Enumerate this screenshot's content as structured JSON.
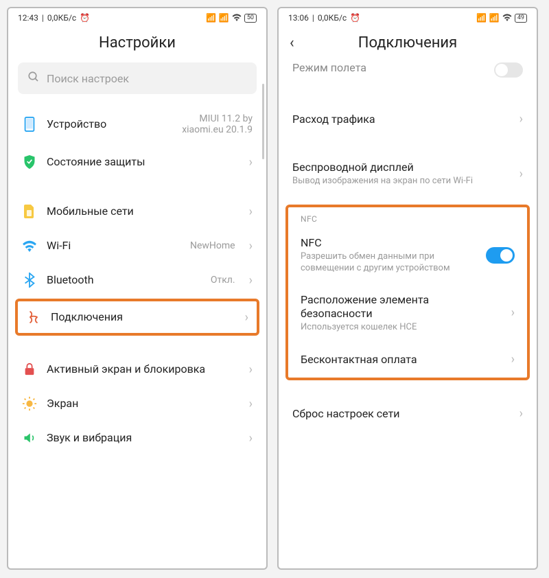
{
  "left": {
    "status": {
      "time": "12:43",
      "data": "0,0КБ/с",
      "battery": "50"
    },
    "title": "Настройки",
    "search_placeholder": "Поиск настроек",
    "rows": {
      "device": {
        "label": "Устройство",
        "right": "MIUI 11.2 by xiaomi.eu 20.1.9"
      },
      "security": {
        "label": "Состояние защиты"
      },
      "mobile": {
        "label": "Мобильные сети"
      },
      "wifi": {
        "label": "Wi-Fi",
        "right": "NewHome"
      },
      "bluetooth": {
        "label": "Bluetooth",
        "right": "Откл."
      },
      "connections": {
        "label": "Подключения"
      },
      "lock": {
        "label": "Активный экран и блокировка"
      },
      "display": {
        "label": "Экран"
      },
      "sound": {
        "label": "Звук и вибрация"
      }
    }
  },
  "right": {
    "status": {
      "time": "13:06",
      "data": "0,0КБ/с",
      "battery": "49"
    },
    "title": "Подключения",
    "cutoff": "Режим полета",
    "rows": {
      "traffic": {
        "label": "Расход трафика"
      },
      "cast": {
        "label": "Беспроводной дисплей",
        "sub": "Вывод изображения на экран по сети Wi-Fi"
      },
      "nfc_header": "NFC",
      "nfc": {
        "label": "NFC",
        "sub": "Разрешить обмен данными при совмещении с другим устройством"
      },
      "secelem": {
        "label": "Расположение элемента безопасности",
        "sub": "Используется кошелек HCE"
      },
      "tap": {
        "label": "Бесконтактная оплата"
      },
      "reset": {
        "label": "Сброс настроек сети"
      }
    }
  }
}
